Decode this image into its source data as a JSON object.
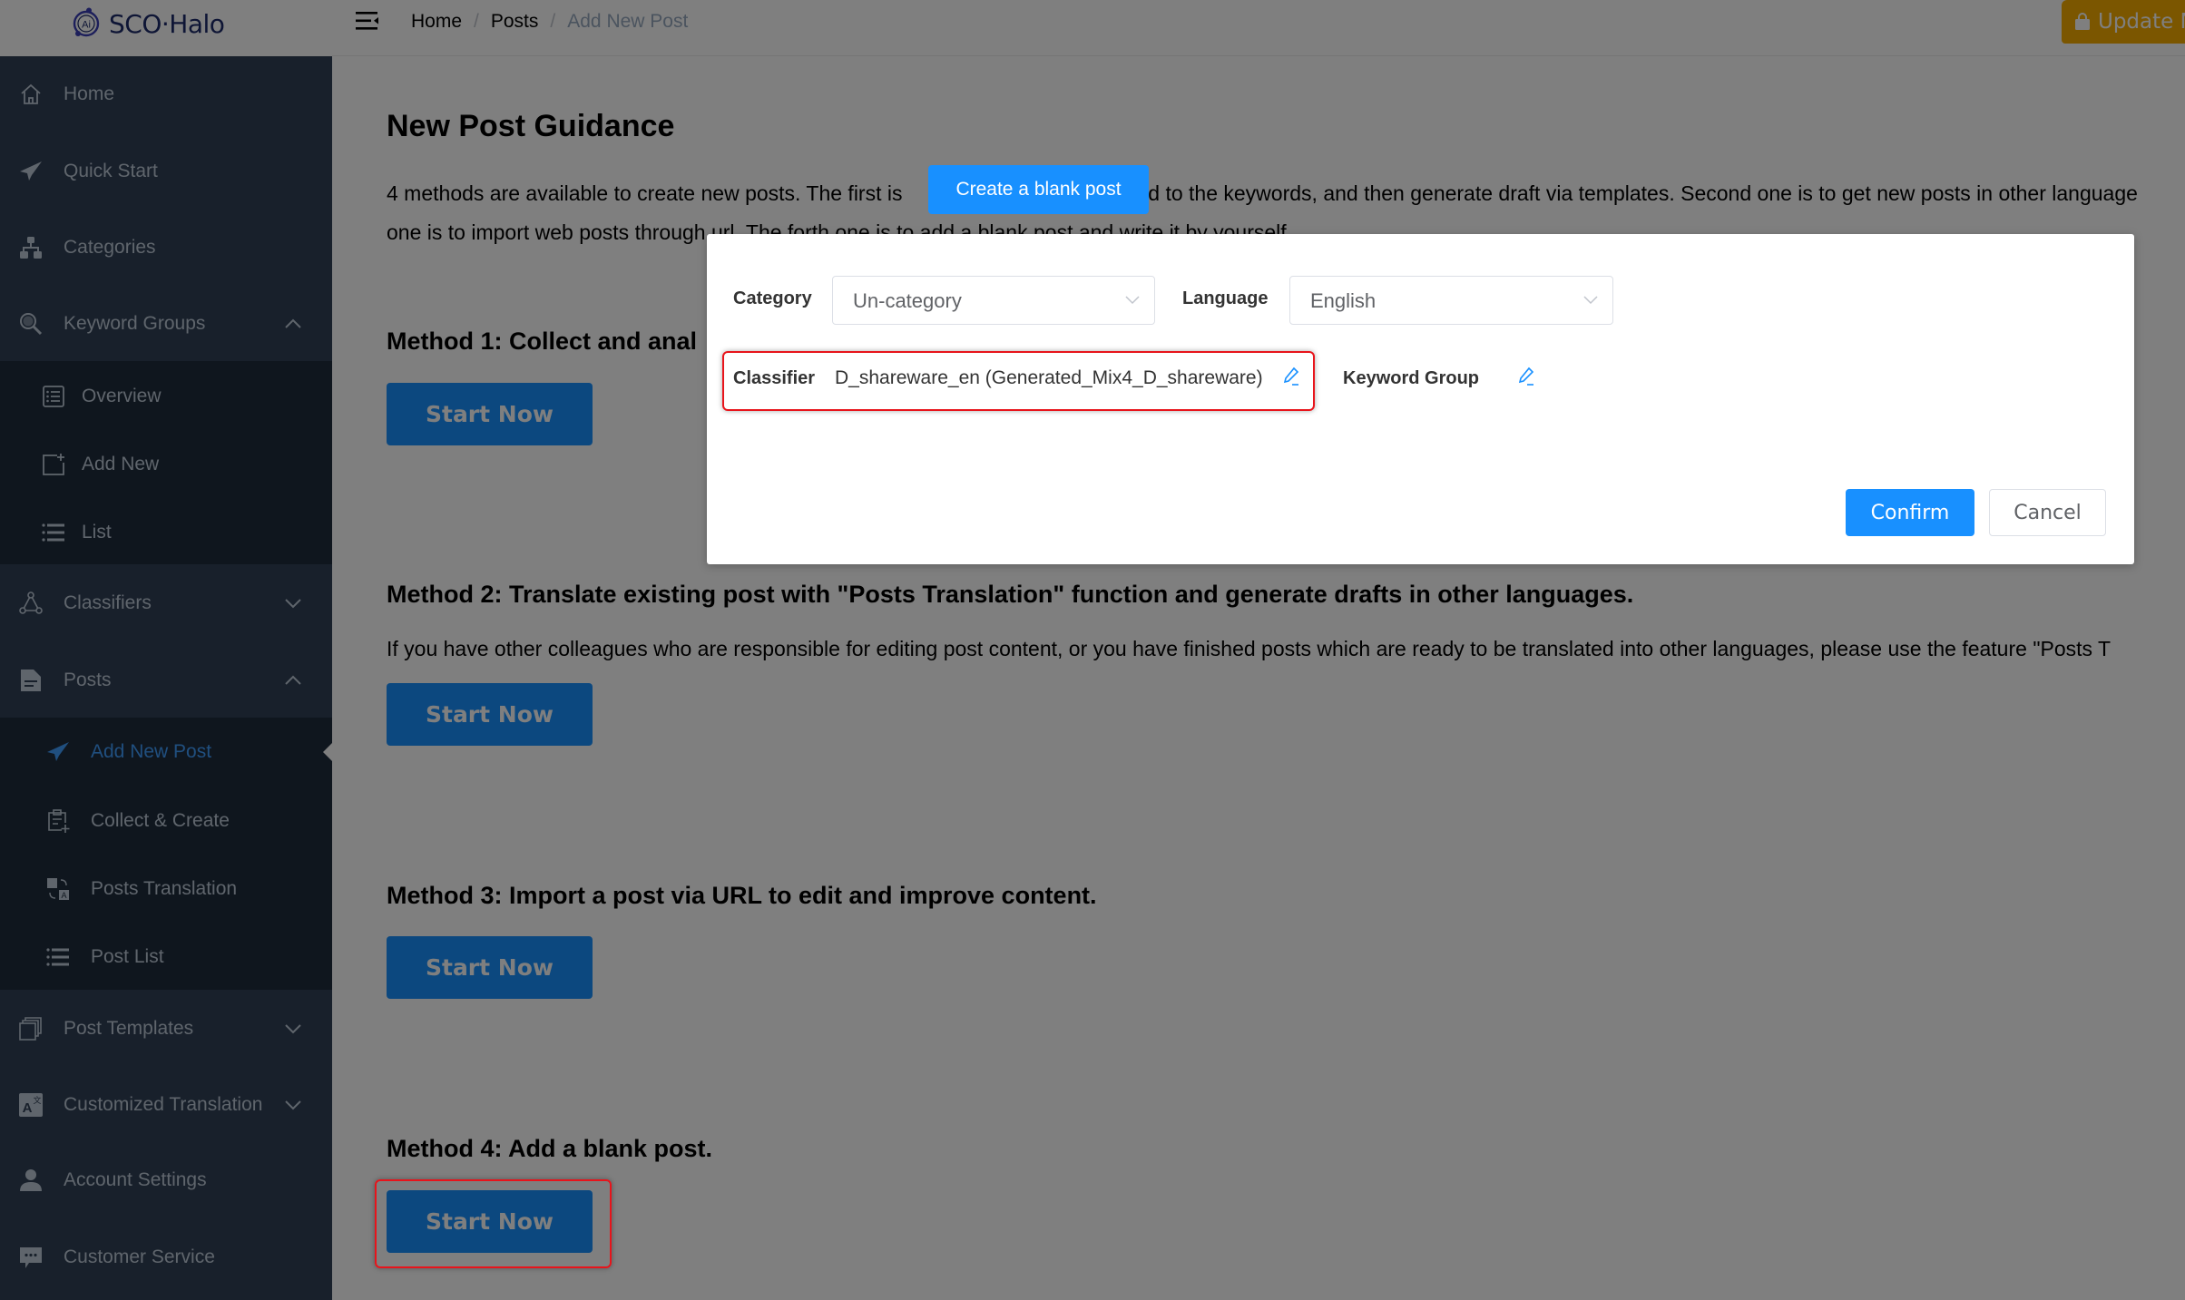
{
  "app": {
    "logo_text": "SCO·Halo",
    "logo_badge": "Ai"
  },
  "header": {
    "breadcrumb": [
      "Home",
      "Posts",
      "Add New Post"
    ],
    "breadcrumb_separator": "/",
    "update_button": "Update N",
    "update_color": "#f7ad00"
  },
  "sidebar": {
    "items": [
      {
        "label": "Home",
        "icon": "home-icon"
      },
      {
        "label": "Quick Start",
        "icon": "paper-plane-icon"
      },
      {
        "label": "Categories",
        "icon": "sitemap-icon"
      },
      {
        "label": "Keyword Groups",
        "icon": "key-search-icon",
        "expanded": true
      },
      {
        "label": "Overview",
        "icon": "list-box-icon"
      },
      {
        "label": "Add New",
        "icon": "add-doc-icon"
      },
      {
        "label": "List",
        "icon": "list-icon"
      },
      {
        "label": "Classifiers",
        "icon": "triangle-nodes-icon",
        "expanded": false
      },
      {
        "label": "Posts",
        "icon": "document-icon",
        "expanded": true
      },
      {
        "label": "Add New Post",
        "icon": "paper-plane-icon",
        "active": true
      },
      {
        "label": "Collect & Create",
        "icon": "clipboard-plus-icon"
      },
      {
        "label": "Posts Translation",
        "icon": "translate-icon"
      },
      {
        "label": "Post List",
        "icon": "list-icon"
      },
      {
        "label": "Post Templates",
        "icon": "stacked-pages-icon",
        "expanded": false
      },
      {
        "label": "Customized Translation",
        "icon": "translate-box-icon",
        "expanded": false
      },
      {
        "label": "Account Settings",
        "icon": "user-icon"
      },
      {
        "label": "Customer Service",
        "icon": "chat-icon"
      }
    ],
    "active_color": "#409eff"
  },
  "main": {
    "title": "New Post Guidance",
    "intro_line1_a": "4 methods are available to create new posts. The first is",
    "intro_line1_b": "ed to the keywords, and then generate draft via templates. Second one is to get new posts in other language",
    "intro_line2": "one is to import web posts through url. The forth one is to add a blank post and write it by yourself.",
    "methods": [
      {
        "title": "Method 1: Collect and anal",
        "button": "Start Now"
      },
      {
        "title": "Method 2:  Translate existing post with \"Posts Translation\" function and generate drafts in other languages.",
        "description": "If you have other colleagues who are responsible for editing post content, or you have finished posts which are ready to be translated into other languages, please use the feature \"Posts T",
        "button": "Start Now"
      },
      {
        "title": "Method 3: Import a post via URL to edit and improve content.",
        "button": "Start Now"
      },
      {
        "title": "Method 4: Add a blank post.",
        "button": "Start Now",
        "highlighted": true
      }
    ]
  },
  "tooltip": {
    "text": "Create a blank post"
  },
  "modal": {
    "category_label": "Category",
    "category_value": "Un-category",
    "language_label": "Language",
    "language_value": "English",
    "classifier_label": "Classifier",
    "classifier_value": "D_shareware_en (Generated_Mix4_D_shareware)",
    "keyword_group_label": "Keyword Group",
    "keyword_group_value": "",
    "confirm": "Confirm",
    "cancel": "Cancel",
    "primary_color": "#1890ff",
    "highlight_color": "#e8141b"
  }
}
